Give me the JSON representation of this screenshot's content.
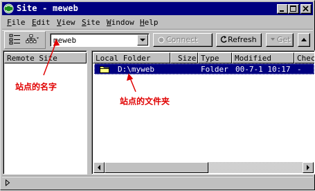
{
  "window": {
    "title": "Site - meweb"
  },
  "menu": [
    {
      "label": "File",
      "key": "F",
      "rest": "ile"
    },
    {
      "label": "Edit",
      "key": "E",
      "rest": "dit"
    },
    {
      "label": "View",
      "key": "V",
      "rest": "iew"
    },
    {
      "label": "Site",
      "key": "S",
      "rest": "ite"
    },
    {
      "label": "Window",
      "key": "W",
      "rest": "indow"
    },
    {
      "label": "Help",
      "key": "H",
      "rest": "elp"
    }
  ],
  "toolbar": {
    "site_value": "meweb",
    "connect_label": "Connect",
    "refresh_label": "Refresh",
    "get_label": "Get"
  },
  "left_pane": {
    "header": "Remote Site"
  },
  "right_pane": {
    "columns": [
      "Local Folder",
      "Size",
      "Type",
      "Modified",
      "Checked"
    ],
    "row": {
      "name": "D:\\myweb",
      "type": "Folder",
      "modified": "00-7-1 10:17",
      "checked": "-"
    }
  },
  "annotations": {
    "site_name": "站点的名字",
    "site_folder": "站点的文件夹"
  },
  "colors": {
    "titlebar": "#000080",
    "selection": "#000080",
    "annotation": "#e00000",
    "face": "#c0c0c0"
  }
}
